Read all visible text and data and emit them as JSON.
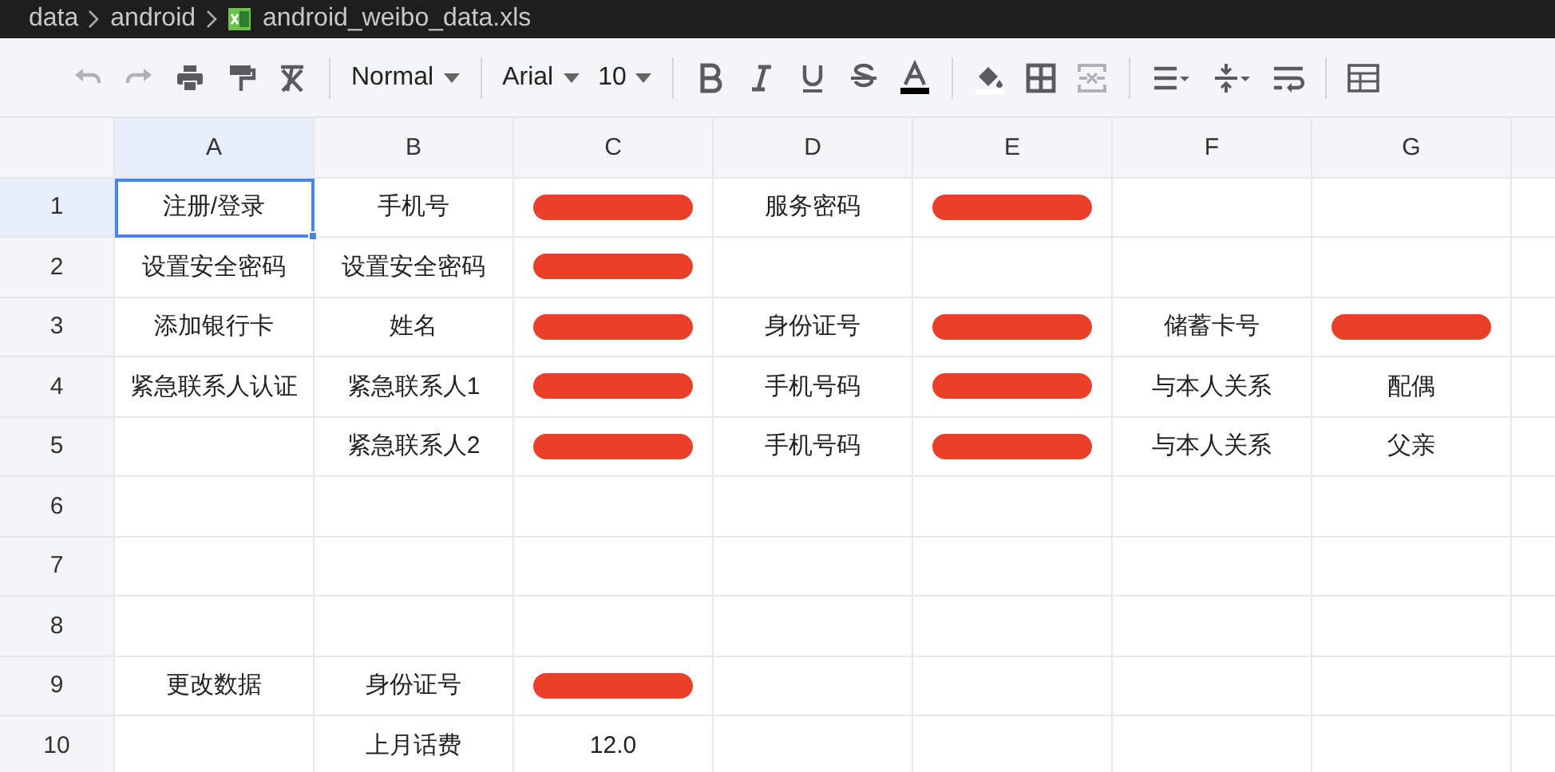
{
  "breadcrumb": [
    {
      "text": "data",
      "kind": "folder"
    },
    {
      "text": "android",
      "kind": "folder"
    },
    {
      "text": "android_weibo_data.xls",
      "kind": "file"
    }
  ],
  "toolbar": [
    {
      "kind": "undo",
      "disabled": true
    },
    {
      "kind": "redo",
      "disabled": true
    },
    {
      "kind": "print",
      "disabled": false
    },
    {
      "kind": "paint",
      "disabled": false
    },
    {
      "kind": "clear",
      "disabled": false
    },
    {
      "kind": "separator"
    },
    {
      "kind": "dropdown",
      "text": "Normal"
    },
    {
      "kind": "separator"
    },
    {
      "kind": "dropdown",
      "text": "Arial"
    },
    {
      "kind": "dropdown",
      "text": "10"
    },
    {
      "kind": "separator"
    },
    {
      "kind": "bold",
      "disabled": false
    },
    {
      "kind": "italic",
      "disabled": false
    },
    {
      "kind": "underline",
      "disabled": false
    },
    {
      "kind": "strike",
      "disabled": false
    },
    {
      "kind": "textcolor",
      "disabled": false,
      "color": "#000000"
    },
    {
      "kind": "separator"
    },
    {
      "kind": "fill",
      "disabled": false,
      "color": "#ffffff"
    },
    {
      "kind": "borders",
      "disabled": false
    },
    {
      "kind": "merge",
      "disabled": true
    },
    {
      "kind": "separator"
    },
    {
      "kind": "halign",
      "disabled": false
    },
    {
      "kind": "valign",
      "disabled": false
    },
    {
      "kind": "wrap",
      "disabled": false
    },
    {
      "kind": "separator"
    },
    {
      "kind": "table",
      "disabled": false
    }
  ],
  "sheet": {
    "columns": [
      {
        "label": "A",
        "selected": true
      },
      {
        "label": "B",
        "selected": false
      },
      {
        "label": "C",
        "selected": false
      },
      {
        "label": "D",
        "selected": false
      },
      {
        "label": "E",
        "selected": false
      },
      {
        "label": "F",
        "selected": false
      },
      {
        "label": "G",
        "selected": false
      }
    ],
    "rows": [
      {
        "label": "1",
        "selected": true,
        "cells": [
          {
            "text": "注册/登录"
          },
          {
            "text": "手机号"
          },
          {
            "redacted": true
          },
          {
            "text": "服务密码"
          },
          {
            "redacted": true
          },
          null,
          null
        ]
      },
      {
        "label": "2",
        "selected": false,
        "cells": [
          {
            "text": "设置安全密码"
          },
          {
            "text": "设置安全密码"
          },
          {
            "redacted": true
          },
          null,
          null,
          null,
          null
        ]
      },
      {
        "label": "3",
        "selected": false,
        "cells": [
          {
            "text": "添加银行卡"
          },
          {
            "text": "姓名"
          },
          {
            "redacted": true
          },
          {
            "text": "身份证号"
          },
          {
            "redacted": true
          },
          {
            "text": "储蓄卡号"
          },
          {
            "redacted": true
          }
        ]
      },
      {
        "label": "4",
        "selected": false,
        "cells": [
          {
            "text": "紧急联系人认证"
          },
          {
            "text": "紧急联系人1"
          },
          {
            "redacted": true
          },
          {
            "text": "手机号码"
          },
          {
            "redacted": true
          },
          {
            "text": "与本人关系"
          },
          {
            "text": "配偶"
          }
        ]
      },
      {
        "label": "5",
        "selected": false,
        "cells": [
          null,
          {
            "text": "紧急联系人2"
          },
          {
            "redacted": true
          },
          {
            "text": "手机号码"
          },
          {
            "redacted": true
          },
          {
            "text": "与本人关系"
          },
          {
            "text": "父亲"
          }
        ]
      },
      {
        "label": "6",
        "selected": false,
        "cells": [
          null,
          null,
          null,
          null,
          null,
          null,
          null
        ]
      },
      {
        "label": "7",
        "selected": false,
        "cells": [
          null,
          null,
          null,
          null,
          null,
          null,
          null
        ]
      },
      {
        "label": "8",
        "selected": false,
        "cells": [
          null,
          null,
          null,
          null,
          null,
          null,
          null
        ]
      },
      {
        "label": "9",
        "selected": false,
        "cells": [
          {
            "text": "更改数据"
          },
          {
            "text": "身份证号"
          },
          {
            "redacted": true
          },
          null,
          null,
          null,
          null
        ]
      },
      {
        "label": "10",
        "selected": false,
        "cells": [
          null,
          {
            "text": "上月话费"
          },
          {
            "text": "12.0"
          },
          null,
          null,
          null,
          null
        ]
      }
    ]
  }
}
